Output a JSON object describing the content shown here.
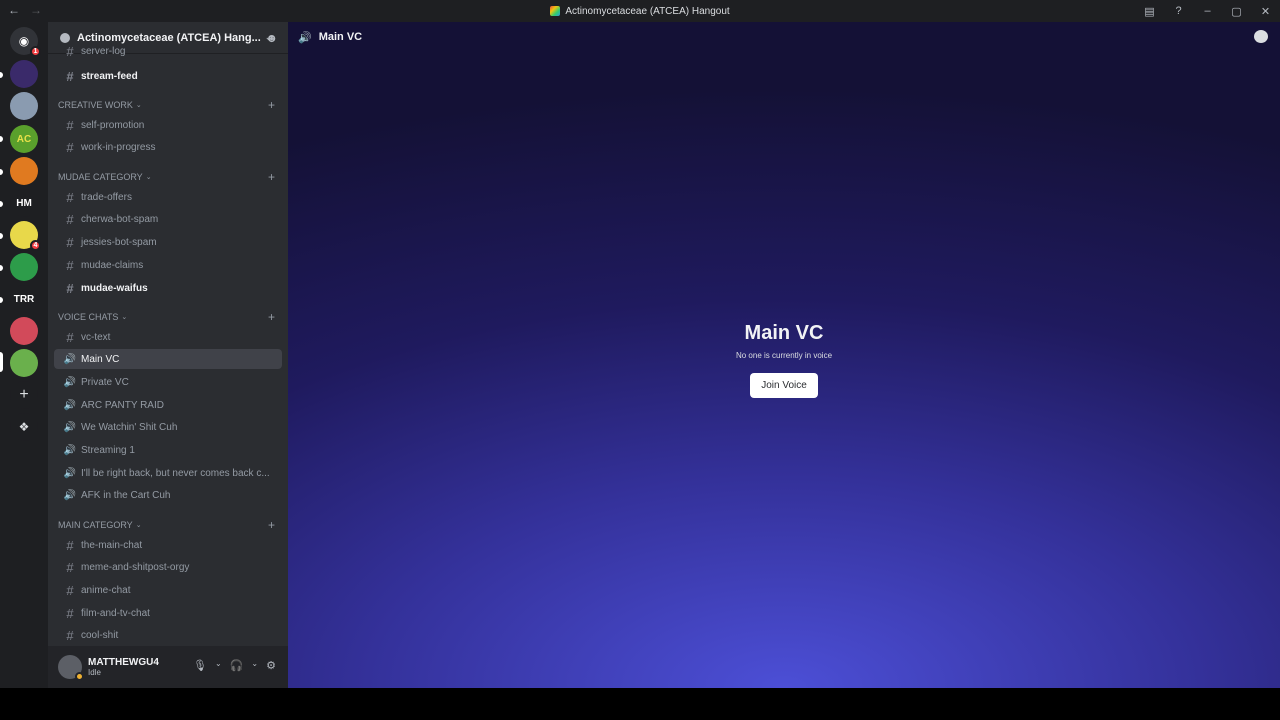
{
  "window": {
    "title": "Actinomycetaceae (ATCEA) Hangout",
    "back_glyph": "←",
    "forward_glyph": "→",
    "controls": [
      "‒",
      "▢",
      "✕"
    ]
  },
  "servers": {
    "dm_badge": "1",
    "items": [
      {
        "name": "server-1",
        "color": "#3a2a6a"
      },
      {
        "name": "server-2",
        "color": "#8a9bb0"
      },
      {
        "name": "server-ac",
        "label": "AC",
        "color": "#5aa02c"
      },
      {
        "name": "server-4",
        "color": "#e07a20"
      },
      {
        "name": "server-hm",
        "label": "HM",
        "color": "#1e1f22"
      },
      {
        "name": "server-6",
        "color": "#e8d84a",
        "badge": "4"
      },
      {
        "name": "server-7",
        "color": "#2d9c4a"
      },
      {
        "name": "server-trr",
        "label": "TRR",
        "color": "#1e1f22"
      },
      {
        "name": "server-9",
        "color": "#d24a5a"
      },
      {
        "name": "server-10",
        "color": "#6ab04c"
      }
    ]
  },
  "guild": {
    "name": "Actinomycetaceae (ATCEA) Hang...",
    "chevron": "⌄"
  },
  "channels": {
    "partial_top": "server-log",
    "stream_feed": "stream-feed",
    "categories": {
      "creative": "CREATIVE WORK",
      "mudae": "MUDAE CATEGORY",
      "voice": "VOICE CHATS",
      "main": "MAIN CATEGORY"
    },
    "creative_items": [
      "self-promotion",
      "work-in-progress"
    ],
    "mudae_items": [
      "trade-offers",
      "cherwa-bot-spam",
      "jessies-bot-spam",
      "mudae-claims",
      "mudae-waifus"
    ],
    "voice_text": "vc-text",
    "voice_items": [
      "Main VC",
      "Private VC",
      "ARC PANTY RAID",
      "We Watchin' Shit Cuh",
      "Streaming 1",
      "I'll be right back, but never comes back c...",
      "AFK in the Cart Cuh"
    ],
    "main_items": [
      "the-main-chat",
      "meme-and-shitpost-orgy",
      "anime-chat",
      "film-and-tv-chat",
      "cool-shit"
    ]
  },
  "user": {
    "name": "MATTHEWGU4",
    "status": "Idle"
  },
  "main": {
    "header_title": "Main VC",
    "heading": "Main VC",
    "subtitle": "No one is currently in voice",
    "join_label": "Join Voice"
  }
}
